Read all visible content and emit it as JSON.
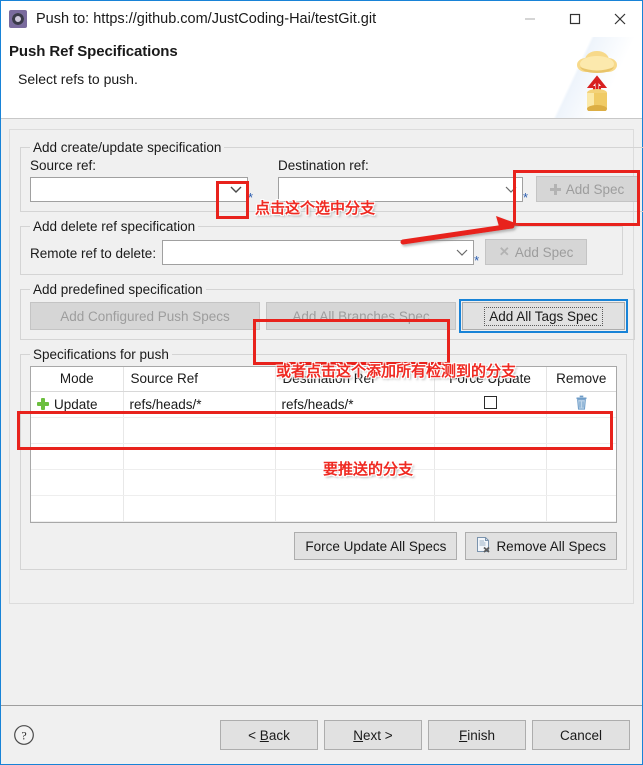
{
  "window": {
    "app_icon": "gear-icon",
    "title": "Push to: https://github.com/JustCoding-Hai/testGit.git",
    "minimize": "minimize-icon",
    "maximize": "maximize-icon",
    "close": "close-icon"
  },
  "header": {
    "title": "Push Ref Specifications",
    "subtitle": "Select refs to push.",
    "banner_icon": "cloud-upload-icon"
  },
  "create_update": {
    "legend": "Add create/update specification",
    "source_label": "Source ref:",
    "source_value": "",
    "source_required_marker": "*",
    "destination_label": "Destination ref:",
    "destination_value": "",
    "destination_required_marker": "*",
    "add_spec_label": "Add Spec",
    "add_spec_icon": "plus-icon",
    "add_spec_disabled": true
  },
  "delete_ref": {
    "legend": "Add delete ref specification",
    "remote_label": "Remote ref to delete:",
    "remote_value": "",
    "remote_required_marker": "*",
    "add_spec_label": "Add Spec",
    "add_spec_icon": "x-icon",
    "add_spec_disabled": true
  },
  "predefined": {
    "legend": "Add predefined specification",
    "buttons": [
      {
        "label": "Add Configured Push Specs",
        "disabled": true,
        "focused": false
      },
      {
        "label": "Add All Branches Spec",
        "disabled": true,
        "focused": false
      },
      {
        "label": "Add All Tags Spec",
        "disabled": false,
        "focused": true
      }
    ]
  },
  "specs": {
    "legend": "Specifications for push",
    "columns": [
      "Mode",
      "Source Ref",
      "Destination Ref",
      "Force Update",
      "Remove"
    ],
    "rows": [
      {
        "mode_icon": "plus-icon",
        "mode": "Update",
        "source_ref": "refs/heads/*",
        "destination_ref": "refs/heads/*",
        "force_update": false,
        "remove_icon": "trash-icon"
      }
    ],
    "empty_row_count": 5,
    "force_update_all_label": "Force Update All Specs",
    "remove_all_label": "Remove All Specs",
    "remove_all_icon": "document-delete-icon"
  },
  "footer": {
    "help_icon": "help-icon",
    "buttons": [
      {
        "label": "< Back",
        "mnemonic": "B"
      },
      {
        "label": "Next >",
        "mnemonic": "N"
      },
      {
        "label": "Finish",
        "mnemonic": "F"
      },
      {
        "label": "Cancel",
        "mnemonic": ""
      }
    ]
  },
  "annotations": {
    "note_1": "点击这个选中分支",
    "note_2": "或者点击这个添加所有检测到的分支",
    "note_3": "要推送的分支"
  },
  "colors": {
    "window_border": "#1883d7",
    "annotation_red": "#ef2a22",
    "highlight_red": "#e8221c",
    "focus_blue": "#1883d7",
    "required_star": "#2a5db0",
    "plus_green": "#6cbf3f",
    "trash_blue": "#6f9dc8",
    "background": "#f0f0f0"
  }
}
